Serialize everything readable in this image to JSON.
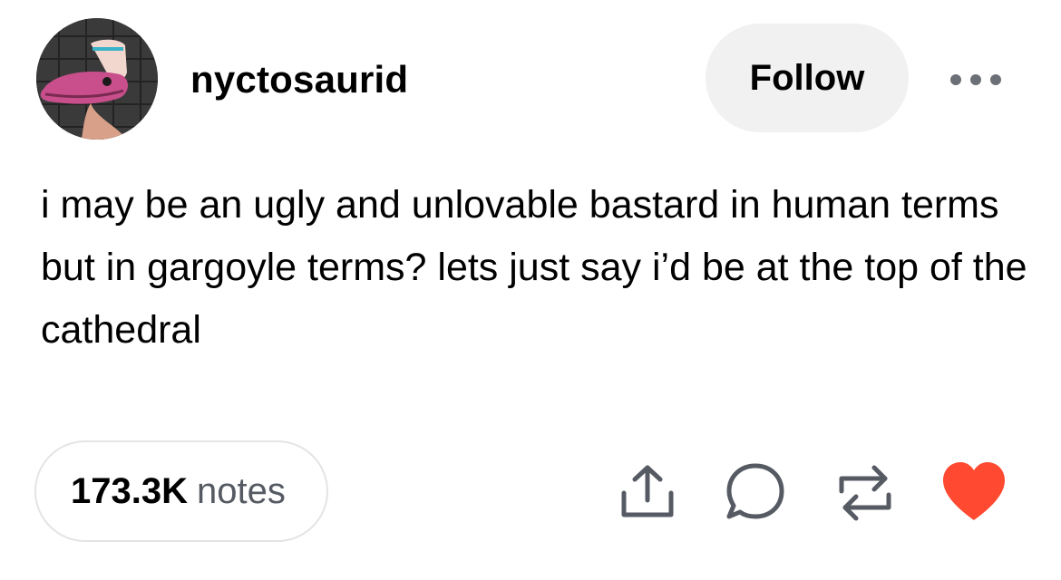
{
  "post": {
    "username": "nyctosaurid",
    "avatar_icon": "avatar-creature-image",
    "follow_label": "Follow",
    "more_icon": "more-dots-icon",
    "text": "i may be an ugly and unlovable bastard in human terms but in gargoyle terms? lets just say i’d be at the top of the cathedral"
  },
  "footer": {
    "notes_count": "173.3K",
    "notes_label": "notes",
    "actions": [
      {
        "icon": "share-icon"
      },
      {
        "icon": "reply-icon"
      },
      {
        "icon": "reblog-icon"
      },
      {
        "icon": "heart-icon",
        "color": "#ff4930",
        "active": true
      }
    ]
  },
  "colors": {
    "follow_bg": "#f1f1f2",
    "icon_stroke": "#555a63",
    "like_active": "#ff4930",
    "pill_border": "#e4e4e6"
  }
}
